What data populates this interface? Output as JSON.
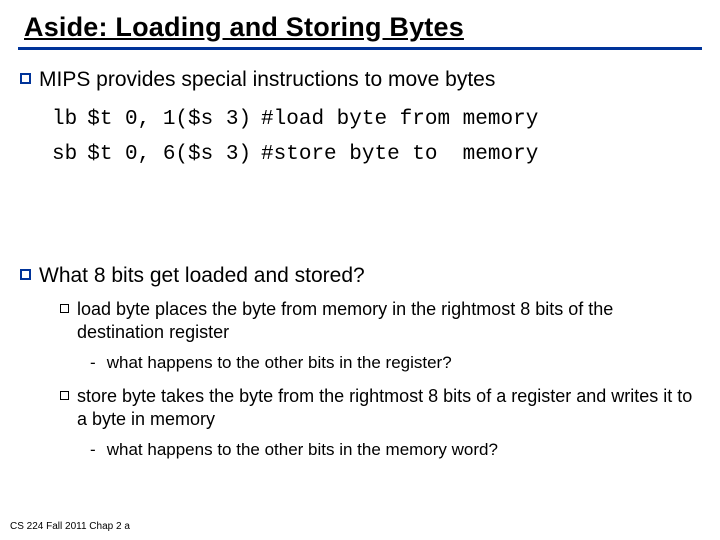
{
  "title": "Aside: Loading and Storing Bytes",
  "bullet1": "MIPS provides special instructions to move bytes",
  "code": {
    "r1": {
      "mn": "lb",
      "ops": "$t 0, 1($s 3)",
      "cm": "#load byte from memory"
    },
    "r2": {
      "mn": "sb",
      "ops": "$t 0, 6($s 3)",
      "cm": "#store byte to  memory"
    }
  },
  "bullet2": "What 8 bits get loaded and stored?",
  "sub1": "load byte places the byte from memory in the rightmost 8 bits of the destination register",
  "sub1q": "what happens to the other bits in the register?",
  "sub2": "store byte takes the byte from the rightmost 8 bits of a register and writes it to a byte in memory",
  "sub2q": "what happens to the other bits in the memory word?",
  "footer": "CS 224 Fall 2011 Chap 2 a"
}
